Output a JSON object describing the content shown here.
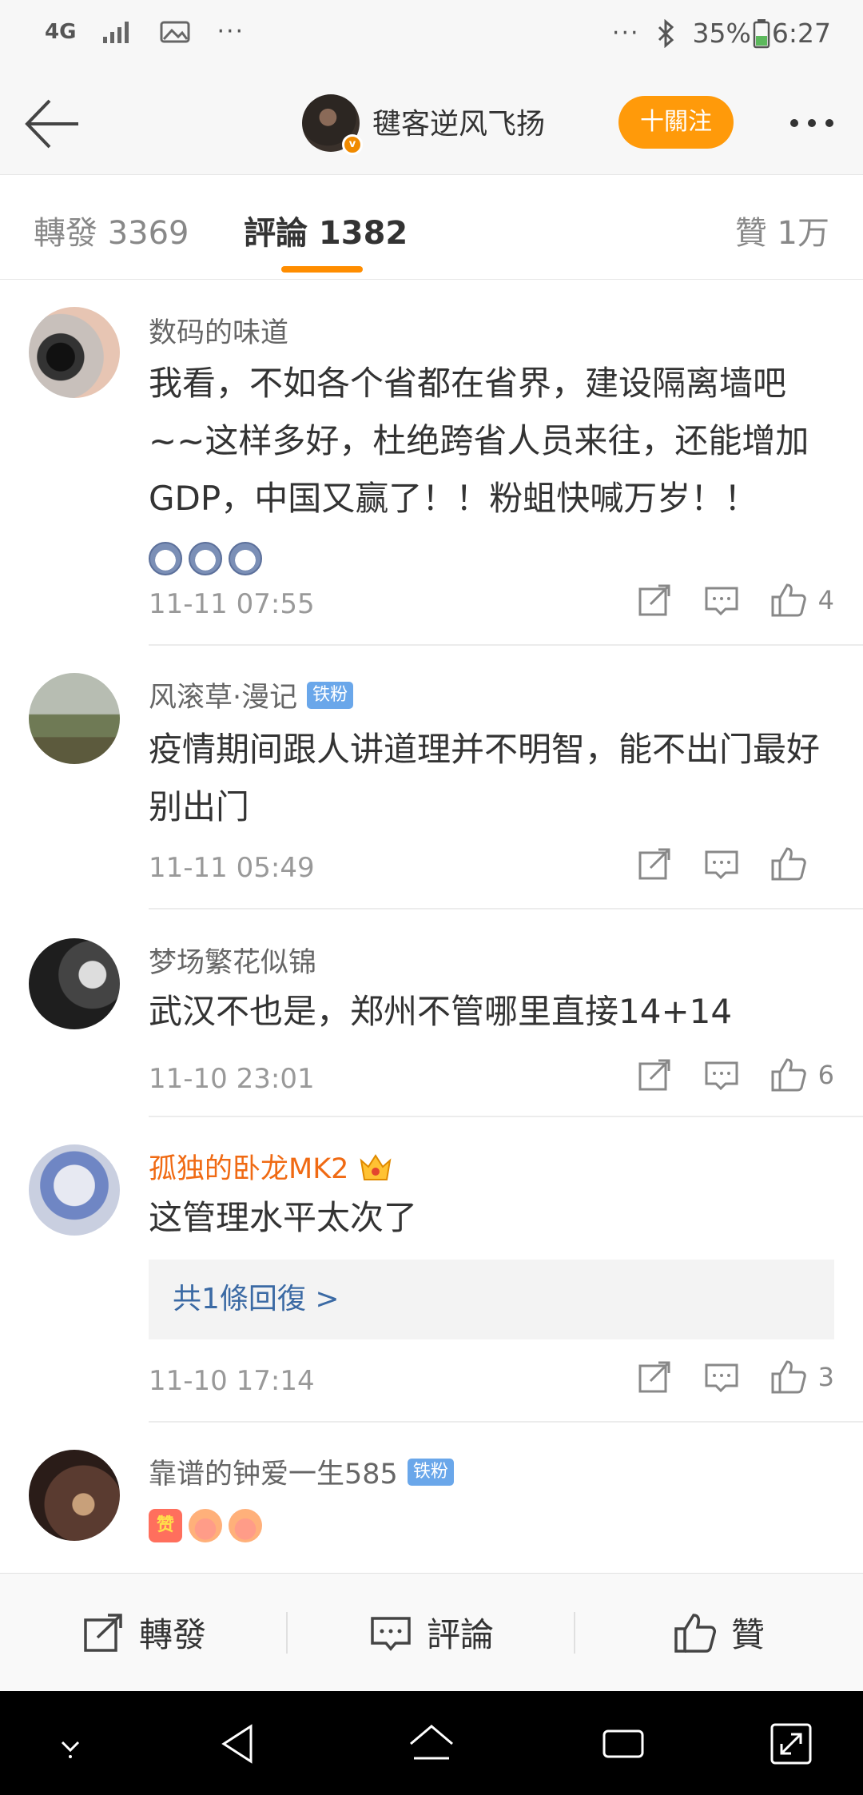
{
  "status_bar": {
    "network": "4G",
    "left_dots": "···",
    "right_dots": "···",
    "battery": "35%",
    "time": "6:27"
  },
  "nav": {
    "username": "毽客逆风飞扬",
    "follow_label": "十關注"
  },
  "tabs": {
    "repost": "轉發 3369",
    "comment": "評論 1382",
    "like": "贊 1万"
  },
  "comments": [
    {
      "name": "数码的味道",
      "text": "我看，不如各个省都在省界，建设隔离墙吧~~这样多好，杜绝跨省人员来往，还能增加GDP，中国又赢了！！粉蛆快喊万岁！！",
      "time": "11-11 07:55",
      "likes": "4"
    },
    {
      "name": "风滚草·漫记",
      "badge": "铁粉",
      "text": "疫情期间跟人讲道理并不明智，能不出门最好别出门",
      "time": "11-11 05:49",
      "likes": ""
    },
    {
      "name": "梦场繁花似锦",
      "text": "武汉不也是，郑州不管哪里直接14+14",
      "time": "11-10 23:01",
      "likes": "6"
    },
    {
      "name": "孤独的卧龙MK2",
      "text": "这管理水平太次了",
      "reply": "共1條回復 >",
      "time": "11-10 17:14",
      "likes": "3"
    },
    {
      "name": "靠谱的钟爱一生585",
      "badge": "铁粉",
      "emoji_zan": "赞"
    }
  ],
  "bottom_bar": {
    "repost": "轉發",
    "comment": "評論",
    "like": "贊"
  },
  "colors": {
    "accent": "#ff9a0a",
    "tab_underline": "#ff8d00",
    "vip_name": "#f06a13",
    "badge_blue": "#6aa7ea",
    "link_blue": "#3b6aa4"
  }
}
